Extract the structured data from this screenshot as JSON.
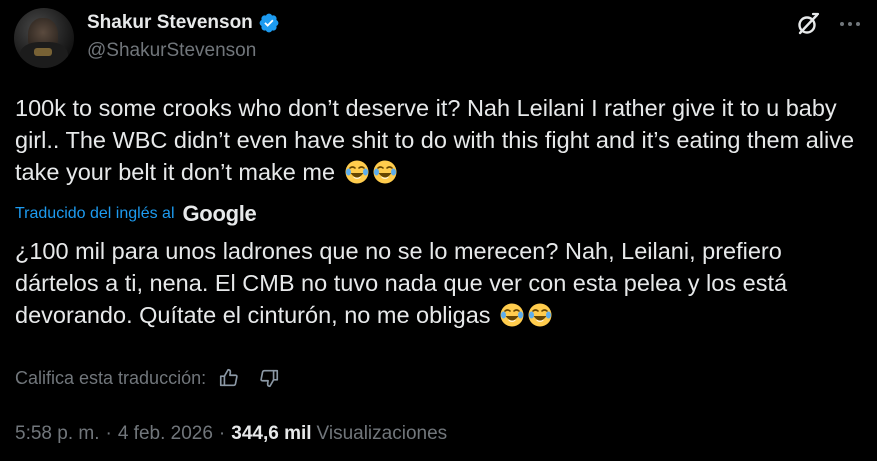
{
  "author": {
    "display_name": "Shakur Stevenson",
    "handle": "@ShakurStevenson",
    "verified": true
  },
  "icons": {
    "verified": "verified-badge-icon",
    "grok": "grok-icon",
    "more": "more-icon",
    "thumbs_up": "thumbs-up-icon",
    "thumbs_down": "thumbs-down-icon",
    "emoji": "tears-of-joy-emoji"
  },
  "tweet": {
    "text": "100k to some crooks who don’t deserve it? Nah Leilani I rather give it to u baby girl.. The WBC didn’t even have shit to do with this fight and it’s eating them alive take your belt it don’t make me",
    "emoji_count": 2
  },
  "translation": {
    "label": "Traducido del inglés al",
    "provider": "Google",
    "text": "¿100 mil para unos ladrones que no se lo merecen? Nah, Leilani, prefiero dártelos a ti, nena. El CMB no tuvo nada que ver con esta pelea y los está devorando. Quítate el cinturón, no me obligas",
    "rate_label": "Califica esta traducción:"
  },
  "meta": {
    "time": "5:58 p. m.",
    "separator": "·",
    "date": "4 feb. 2026",
    "views_count": "344,6 mil",
    "views_label": "Visualizaciones"
  },
  "colors": {
    "background": "#000000",
    "text_primary": "#e7e9ea",
    "text_secondary": "#71767b",
    "accent": "#1d9bf0"
  }
}
